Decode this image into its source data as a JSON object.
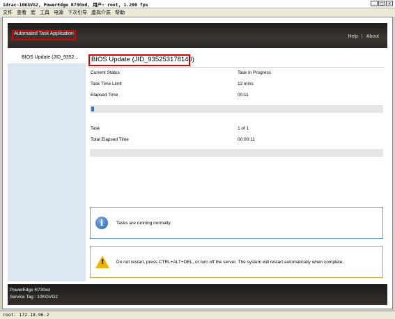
{
  "window": {
    "title": "idrac-10KGVG2, PowerEdge R730xd, 用户: root, 1.200 fps",
    "minimize": "_",
    "maximize": "□",
    "close": "×"
  },
  "menu": [
    "文件",
    "查看",
    "宏",
    "工具",
    "电源",
    "下次引导",
    "虚拟介质",
    "帮助"
  ],
  "header": {
    "app_title": "Automated Task Application",
    "help": "Help",
    "separator": "|",
    "about": "About"
  },
  "leftnav": {
    "items": [
      "BIOS Update (JID_9352..."
    ]
  },
  "main": {
    "title": "BIOS Update (JID_935253178140)",
    "current_status_label": "Current Status",
    "current_status_value": "Task in Progress",
    "time_limit_label": "Task Time Limit",
    "time_limit_value": "12 mins",
    "elapsed_label": "Elapsed Time",
    "elapsed_value": "00:11",
    "task_progress_fraction": 0.01,
    "task_label": "Task",
    "task_value": "1 of 1",
    "total_elapsed_label": "Total Elapsed Time",
    "total_elapsed_value": "00:00:11",
    "info_message": "Tasks are running normally.",
    "info_icon": "i",
    "warning_message": "Do not restart, press CTRL+ALT+DEL, or turn off the server.  The system will restart automatically when complete.",
    "warning_icon": "!"
  },
  "footer": {
    "model": "PowerEdge R730xd",
    "service_tag": "Service Tag : 10KGVG2"
  },
  "statusbar": {
    "text": "root: 172.18.96.2"
  },
  "colors": {
    "highlight_box": "#dd0000",
    "info_border": "#6a9fd0",
    "warning_border": "#e0a040",
    "progress_fill": "#3a6fc4"
  }
}
